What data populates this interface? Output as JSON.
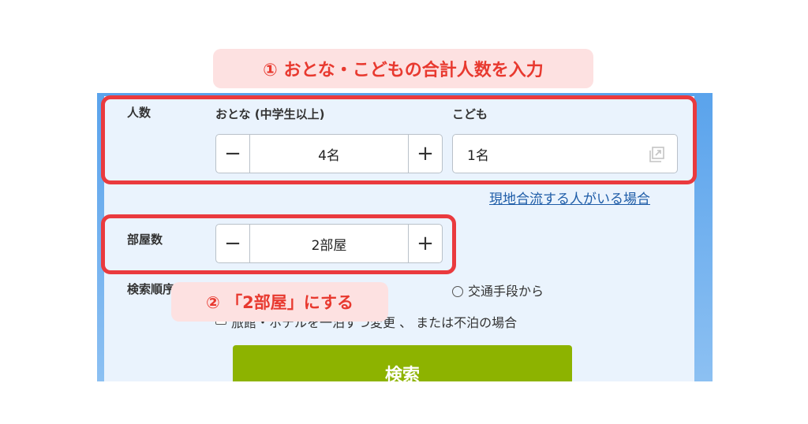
{
  "callouts": {
    "step1": "① おとな・こどもの合計人数を入力",
    "step2": "② 「2部屋」にする"
  },
  "guests": {
    "label": "人数",
    "adult_label": "おとな (中学生以上)",
    "adult_value": "4名",
    "minus": "−",
    "plus": "+",
    "child_label": "こども",
    "child_value": "1名"
  },
  "join_link": "現地合流する人がいる場合",
  "rooms": {
    "label": "部屋数",
    "value": "2部屋",
    "minus": "−",
    "plus": "+"
  },
  "search_order": {
    "label": "検索順序",
    "option_transport": "交通手段から",
    "checkbox_label": "旅館・ホテルを一泊ずつ変更 、 または不泊の場合"
  },
  "search_button": "検索",
  "colors": {
    "highlight": "#ea3a3e",
    "callout_bg": "#fde1e1",
    "callout_text": "#e8392f",
    "search_button": "#8db300",
    "panel_bg": "#eaf3fd",
    "link": "#1f5da8"
  }
}
